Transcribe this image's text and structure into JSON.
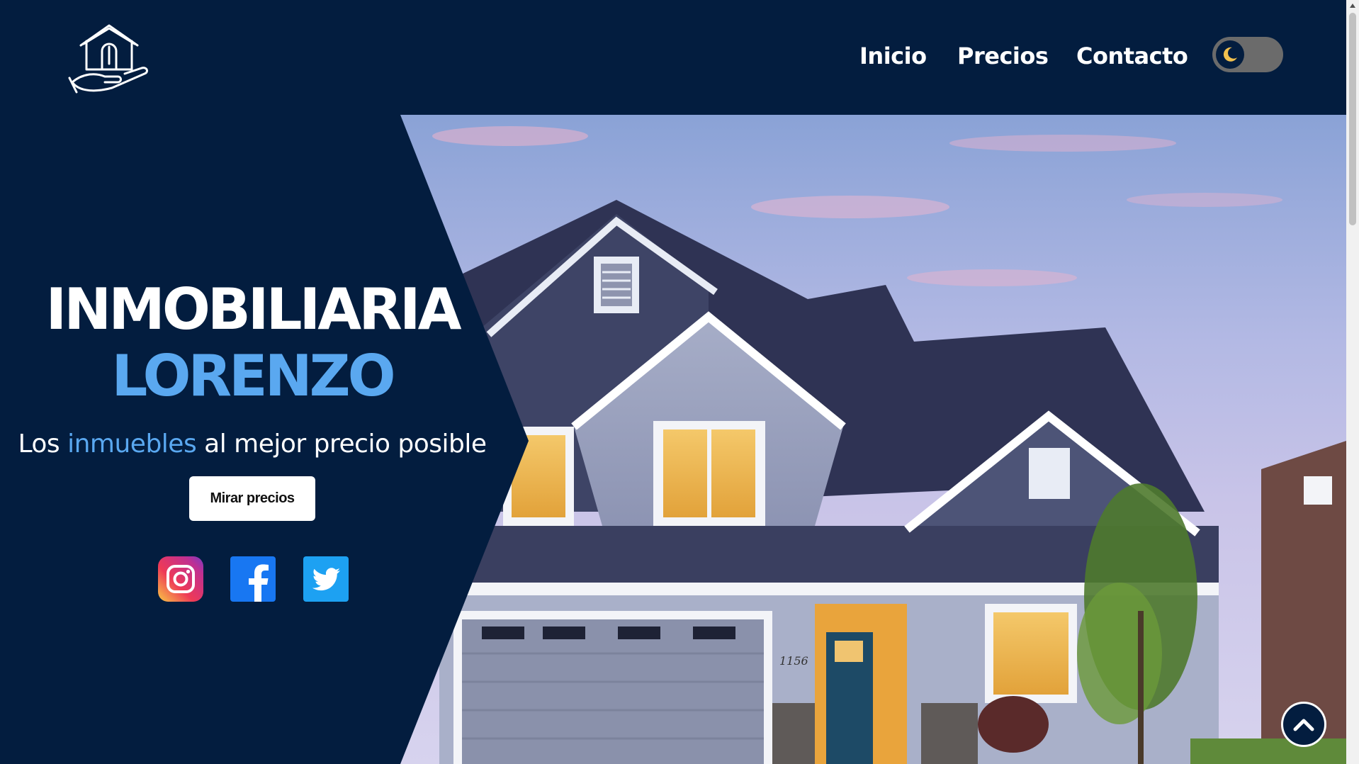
{
  "brand": {
    "logo": "house-in-hand-icon"
  },
  "nav": {
    "items": [
      {
        "label": "Inicio"
      },
      {
        "label": "Precios"
      },
      {
        "label": "Contacto"
      }
    ],
    "theme_toggle": {
      "icon": "moon-icon",
      "state": "dark"
    }
  },
  "hero": {
    "title_line1": "INMOBILIARIA",
    "title_line2": "LORENZO",
    "subtitle_before": "Los ",
    "subtitle_accent": "inmuebles",
    "subtitle_after": " al mejor precio posible",
    "cta_label": "Mirar precios",
    "house_number": "1156",
    "socials": [
      {
        "name": "instagram-icon"
      },
      {
        "name": "facebook-icon"
      },
      {
        "name": "twitter-icon"
      }
    ]
  },
  "scroll_top": {
    "icon": "chevron-up-icon"
  },
  "colors": {
    "navy": "#031d3f",
    "accent_blue": "#5aa8f0",
    "white": "#ffffff",
    "toggle_gray": "#6b6b6b"
  }
}
